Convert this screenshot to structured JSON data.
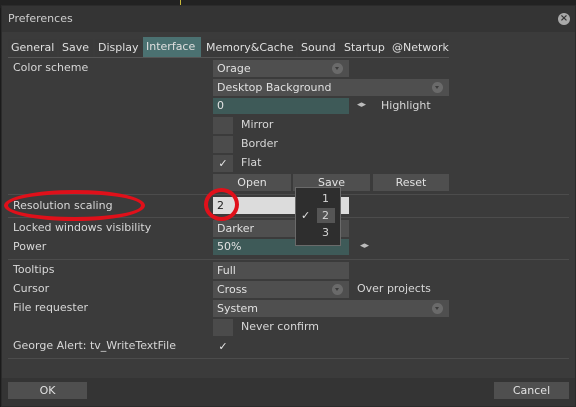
{
  "window": {
    "title": "Preferences",
    "close_icon": "close-icon"
  },
  "tabs": [
    "General",
    "Save",
    "Display",
    "Interface",
    "Memory&Cache",
    "Sound",
    "Startup",
    "@Network"
  ],
  "active_tab": "Interface",
  "settings": {
    "color_scheme": {
      "label": "Color scheme",
      "scheme_value": "Orage",
      "background_value": "Desktop Background",
      "highlight_value": "0",
      "highlight_label": "Highlight",
      "mirror_label": "Mirror",
      "border_label": "Border",
      "flat_label": "Flat",
      "flat_check": "✓",
      "open_label": "Open",
      "save_label": "Save",
      "reset_label": "Reset"
    },
    "resolution_scaling": {
      "label": "Resolution scaling",
      "value": "2",
      "options": [
        "1",
        "2",
        "3"
      ],
      "selected": "2",
      "check": "✓"
    },
    "locked_windows": {
      "label": "Locked windows visibility",
      "value": "Darker"
    },
    "power": {
      "label": "Power",
      "value": "50%"
    },
    "tooltips": {
      "label": "Tooltips",
      "value": "Full"
    },
    "cursor": {
      "label": "Cursor",
      "value": "Cross",
      "extra": "Over projects"
    },
    "file_requester": {
      "label": "File requester",
      "value": "System",
      "never_confirm_label": "Never confirm"
    },
    "george_alert": {
      "label": "George Alert: tv_WriteTextFile",
      "check": "✓"
    }
  },
  "footer": {
    "ok_label": "OK",
    "cancel_label": "Cancel"
  },
  "colors": {
    "accent_tab": "#4b7171",
    "annotation": "#e0101a",
    "field_teal": "#3e5a58"
  }
}
